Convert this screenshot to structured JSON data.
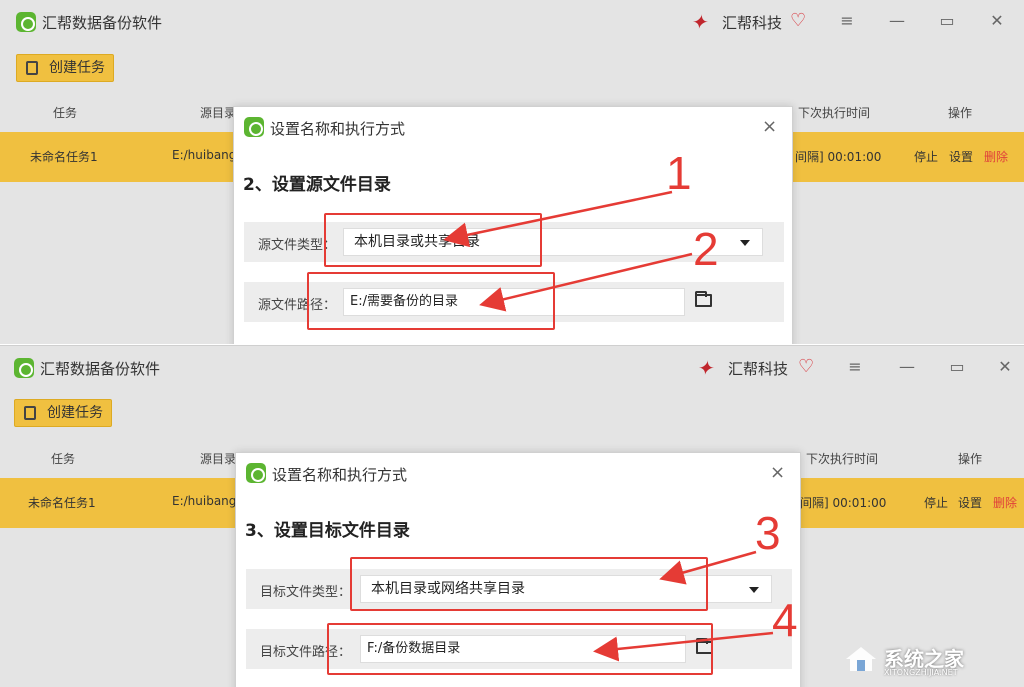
{
  "app": {
    "title": "汇帮数据备份软件",
    "brand": "汇帮科技",
    "brand_color": "#c0262d",
    "accent_color": "#f0c040",
    "icon": "app-logo-icon"
  },
  "window_controls": {
    "menu_icon": "≡",
    "minimize_icon": "—",
    "maximize_icon": "▭",
    "close_icon": "✕"
  },
  "toolbar": {
    "create_task_label": "创建任务"
  },
  "table": {
    "headers": {
      "task": "任务",
      "source_dir": "源目录",
      "next_run": "下次执行时间",
      "actions": "操作"
    },
    "row": {
      "name": "未命名任务1",
      "source": "E:/huibang",
      "interval": "间隔] 00:01:00",
      "interval_top": "[间隔] 00:01:00",
      "stop": "停止",
      "settings": "设置",
      "delete": "删除"
    }
  },
  "dialog": {
    "title": "设置名称和执行方式",
    "close_icon": "×"
  },
  "step2": {
    "heading": "2、设置源文件目录",
    "type_label": "源文件类型：",
    "type_value": "本机目录或共享目录",
    "path_label": "源文件路径：",
    "path_value": "E:/需要备份的目录"
  },
  "step3": {
    "heading": "3、设置目标文件目录",
    "type_label": "目标文件类型：",
    "type_value": "本机目录或网络共享目录",
    "path_label": "目标文件路径：",
    "path_value": "F:/备份数据目录"
  },
  "annotations": {
    "numbers": [
      "1",
      "2",
      "3",
      "4"
    ],
    "color": "#e53b35"
  },
  "watermark": {
    "text": "系统之家",
    "url": "XITONGZHIJIA.NET"
  }
}
